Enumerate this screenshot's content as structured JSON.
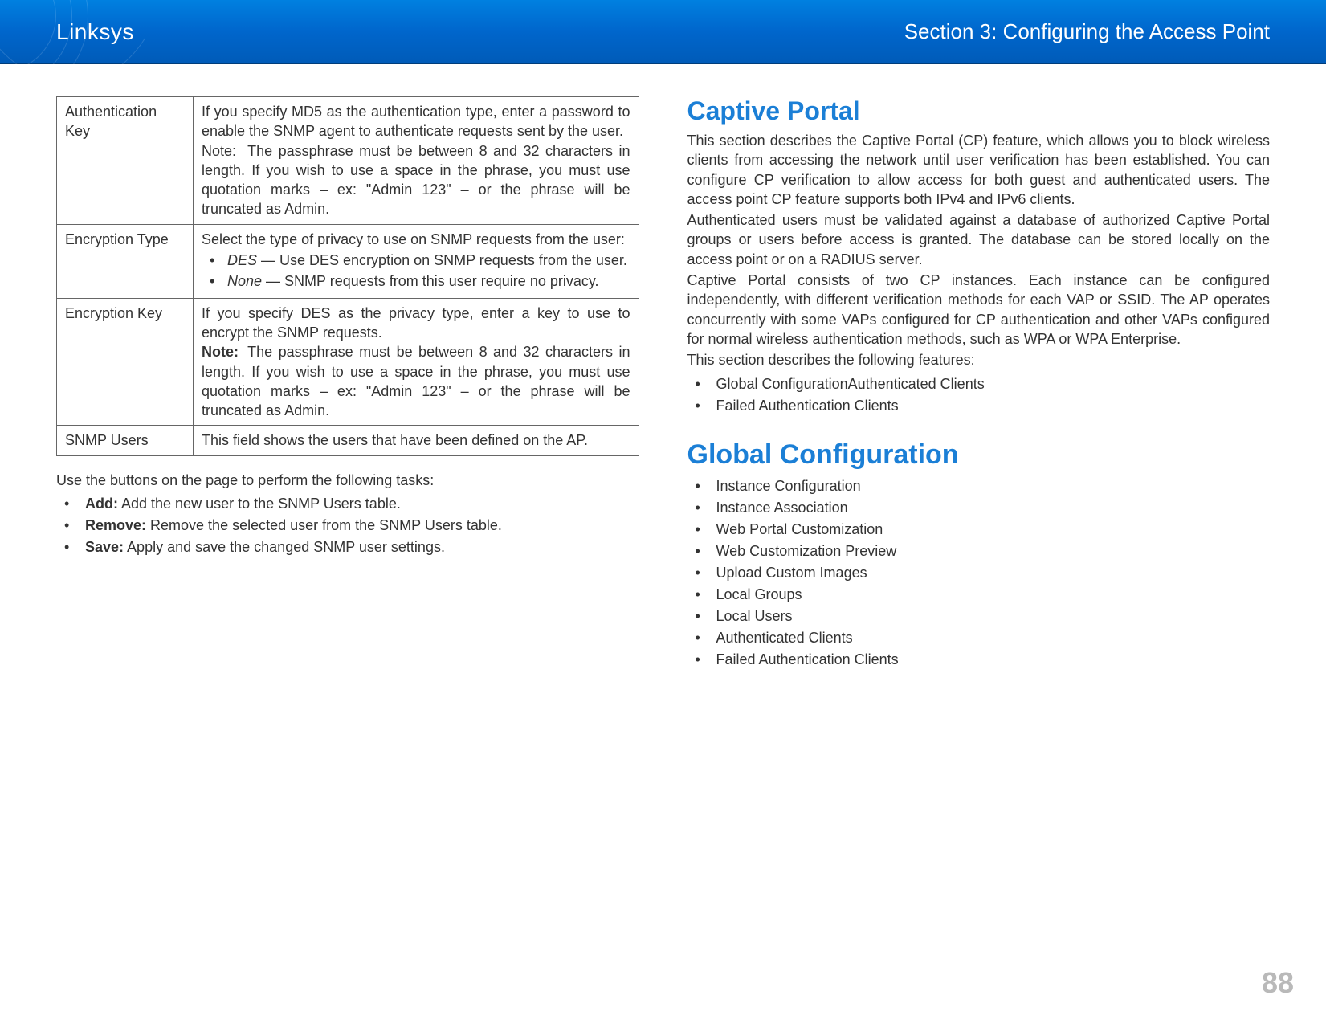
{
  "header": {
    "brand": "Linksys",
    "section": "Section 3:  Configuring the Access Point"
  },
  "left": {
    "table": {
      "rows": [
        {
          "term": "Authentication Key",
          "desc_intro": "If you specify MD5 as the authentication type, enter a password to enable the SNMP agent to authenticate requests sent by the user.",
          "note_label": "Note:",
          "note_text": "The passphrase must be between 8 and 32 characters in length. If you wish to use a space in the phrase, you must use quotation marks – ex: \"Admin 123\" – or the phrase will be truncated as Admin.",
          "note_bold": false
        },
        {
          "term": "Encryption Type",
          "desc_intro": "Select the type of privacy to use on SNMP requests from the user:",
          "items": [
            {
              "name": "DES",
              "text": " — Use DES encryption on SNMP requests from the user."
            },
            {
              "name": "None",
              "text": " — SNMP requests from this user require no privacy."
            }
          ]
        },
        {
          "term": "Encryption Key",
          "desc_intro": "If you specify DES as the privacy type, enter a key to use to encrypt the SNMP requests.",
          "note_label": "Note:",
          "note_text": "The passphrase must be between 8 and 32 characters in length. If you wish to use a space in the phrase, you must use quotation marks – ex: \"Admin 123\" – or the phrase will be truncated as Admin.",
          "note_bold": true
        },
        {
          "term": "SNMP Users",
          "desc_intro": "This field shows the users that have been defined on the AP."
        }
      ]
    },
    "after_table": "Use the buttons on the page to perform the following tasks:",
    "tasks": [
      {
        "lead": "Add:",
        "text": " Add the new user to the SNMP Users table."
      },
      {
        "lead": "Remove:",
        "text": " Remove the selected user from the SNMP Users table."
      },
      {
        "lead": "Save:",
        "text": " Apply and save the changed SNMP user settings."
      }
    ]
  },
  "right": {
    "captive_heading": "Captive Portal",
    "captive_paras": [
      "This section describes the Captive Portal (CP) feature, which allows you to block wireless clients from accessing the network until user verification has been established. You can configure CP verification to allow access for both guest and authenticated users. The access point CP feature supports both IPv4 and IPv6 clients.",
      "Authenticated users must be validated against a database of authorized Captive Portal groups or users before access is granted. The database can be stored locally on the access point or on a RADIUS server.",
      "Captive Portal consists of two CP instances. Each instance can be configured independently, with different verification methods for each VAP or SSID. The AP operates concurrently with some VAPs configured for CP authentication and other VAPs configured for normal wireless authentication methods, such as WPA or WPA Enterprise.",
      "This section describes the following features:"
    ],
    "captive_features": [
      "Global ConfigurationAuthenticated Clients",
      "Failed Authentication Clients"
    ],
    "global_heading": "Global Configuration",
    "global_items": [
      "Instance Configuration",
      "Instance Association",
      "Web Portal Customization",
      "Web Customization Preview",
      "Upload Custom Images",
      "Local Groups",
      "Local Users",
      "Authenticated Clients",
      "Failed Authentication Clients"
    ]
  },
  "page_number": "88"
}
